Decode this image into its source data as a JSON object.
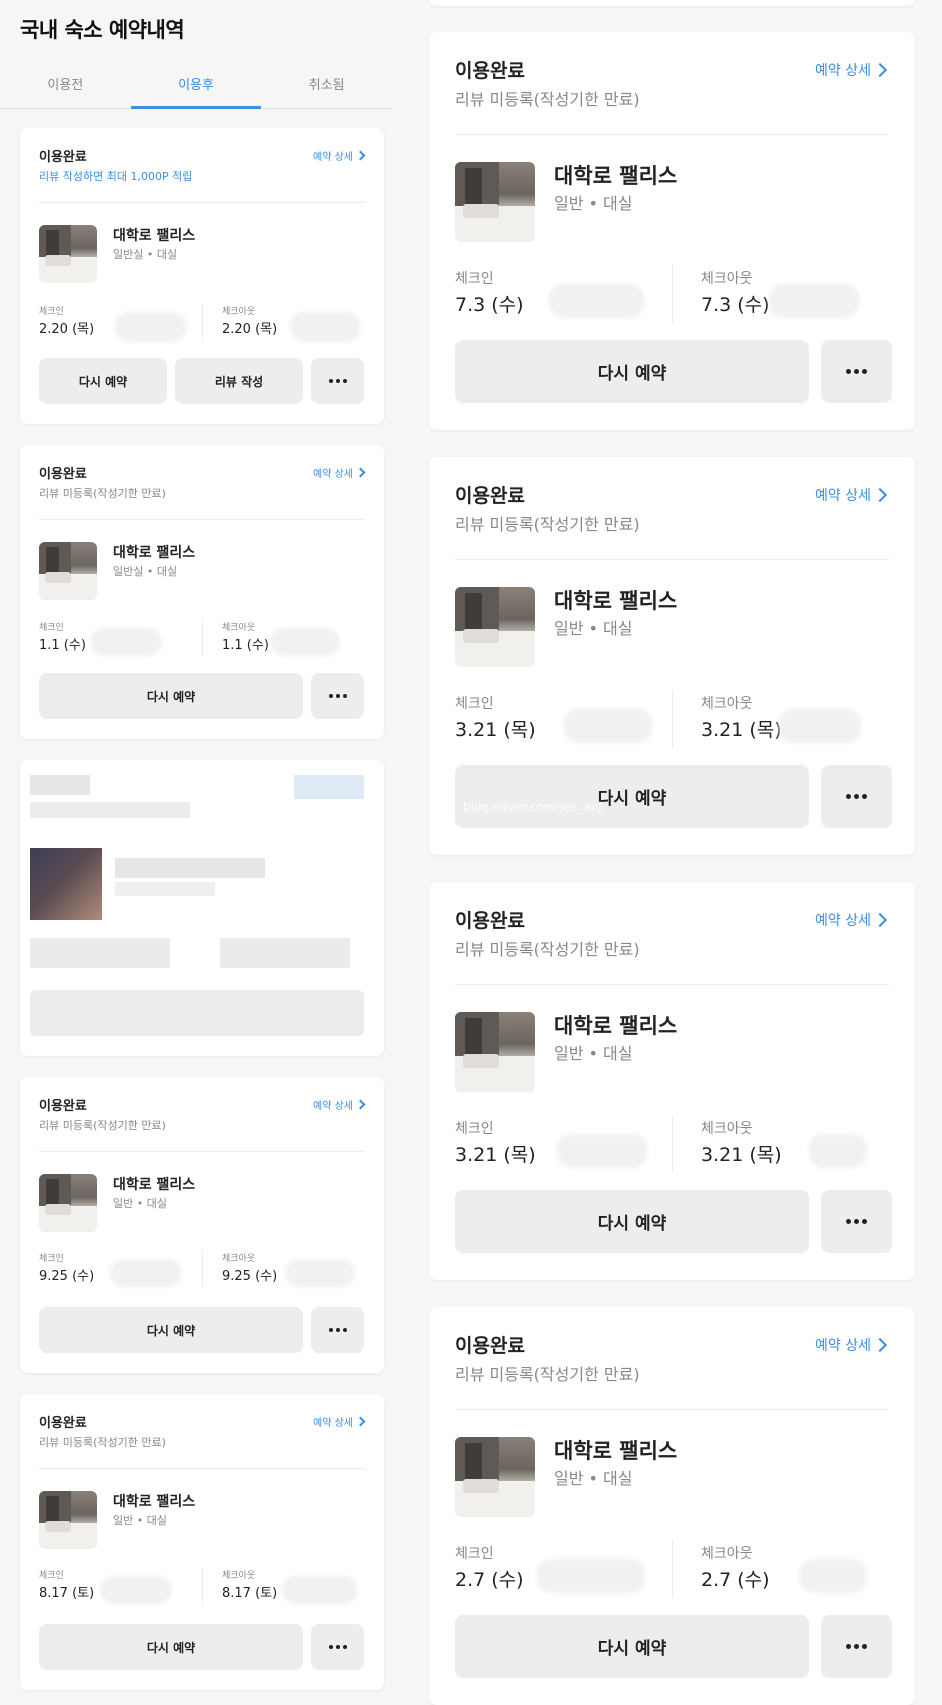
{
  "page": {
    "title": "국내 숙소 예약내역"
  },
  "tabs": [
    {
      "label": "이용전"
    },
    {
      "label": "이용후"
    },
    {
      "label": "취소됨"
    }
  ],
  "common": {
    "detail_label": "예약 상세",
    "checkin_label": "체크인",
    "checkout_label": "체크아웃",
    "rebook_label": "다시 예약",
    "review_label": "리뷰 작성",
    "hotel_name": "대학로 팰리스"
  },
  "left_cards": [
    {
      "status": "이용완료",
      "sub": "리뷰 작성하면 최대 1,000P 적립",
      "room": "일반실 • 대실",
      "checkin": "2.20 (목)",
      "checkout": "2.20 (목)"
    },
    {
      "status": "이용완료",
      "sub": "리뷰 미등록(작성기한 만료)",
      "room": "일반실 • 대실",
      "checkin": "1.1 (수)",
      "checkout": "1.1 (수)"
    },
    {
      "status": "이용완료",
      "sub": "리뷰 미등록(작성기한 만료)",
      "room": "일반 • 대실",
      "checkin": "9.25 (수)",
      "checkout": "9.25 (수)"
    },
    {
      "status": "이용완료",
      "sub": "리뷰 미등록(작성기한 만료)",
      "room": "일반 • 대실",
      "checkin": "8.17 (토)",
      "checkout": "8.17 (토)"
    }
  ],
  "right_cards": [
    {
      "status": "이용완료",
      "sub": "리뷰 미등록(작성기한 만료)",
      "room": "일반 • 대실",
      "checkin": "7.3 (수)",
      "checkout": "7.3 (수)"
    },
    {
      "status": "이용완료",
      "sub": "리뷰 미등록(작성기한 만료)",
      "room": "일반 • 대실",
      "checkin": "3.21 (목)",
      "checkout": "3.21 (목)"
    },
    {
      "status": "이용완료",
      "sub": "리뷰 미등록(작성기한 만료)",
      "room": "일반 • 대실",
      "checkin": "3.21 (목)",
      "checkout": "3.21 (목)"
    },
    {
      "status": "이용완료",
      "sub": "리뷰 미등록(작성기한 만료)",
      "room": "일반 • 대실",
      "checkin": "2.7 (수)",
      "checkout": "2.7 (수)"
    }
  ],
  "watermark": "blog.naver.com/jee_aej",
  "colors": {
    "accent": "#3b8ee0",
    "button_bg": "#ededef"
  }
}
